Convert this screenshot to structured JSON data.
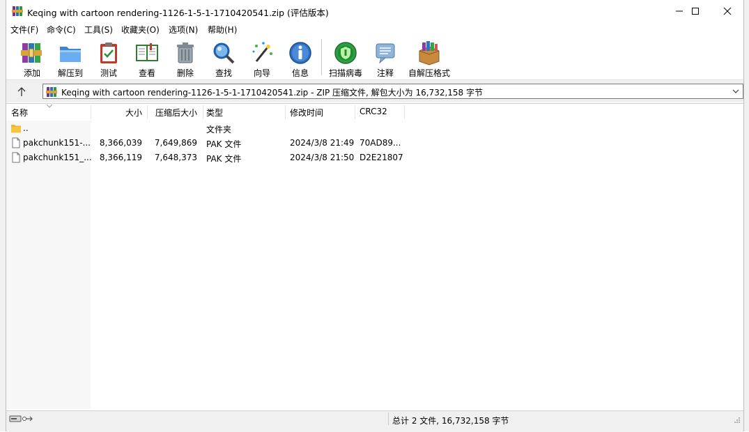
{
  "window": {
    "title": "Keqing with cartoon rendering-1126-1-5-1-1710420541.zip (评估版本)",
    "controls": [
      "minimize",
      "maximize",
      "close"
    ]
  },
  "menu": [
    {
      "label": "文件(F)"
    },
    {
      "label": "命令(C)"
    },
    {
      "label": "工具(S)"
    },
    {
      "label": "收藏夹(O)"
    },
    {
      "label": "选项(N)"
    },
    {
      "label": "帮助(H)"
    }
  ],
  "toolbar": [
    {
      "label": "添加",
      "icon": "add-archive-icon"
    },
    {
      "label": "解压到",
      "icon": "extract-folder-icon"
    },
    {
      "label": "测试",
      "icon": "test-clipboard-icon"
    },
    {
      "label": "查看",
      "icon": "view-book-icon"
    },
    {
      "label": "删除",
      "icon": "trash-icon"
    },
    {
      "label": "查找",
      "icon": "magnifier-icon"
    },
    {
      "label": "向导",
      "icon": "wizard-wand-icon"
    },
    {
      "label": "信息",
      "icon": "info-icon"
    },
    {
      "label": "扫描病毒",
      "icon": "virus-scan-icon"
    },
    {
      "label": "注释",
      "icon": "comment-icon"
    },
    {
      "label": "自解压格式",
      "icon": "sfx-box-icon"
    }
  ],
  "address": {
    "path": "Keqing with cartoon rendering-1126-1-5-1-1710420541.zip - ZIP 压缩文件, 解包大小为 16,732,158 字节"
  },
  "columns": {
    "name": "名称",
    "size": "大小",
    "packed": "压缩后大小",
    "type": "类型",
    "modified": "修改时间",
    "crc": "CRC32"
  },
  "rows": [
    {
      "name": "..",
      "size": "",
      "packed": "",
      "type": "文件夹",
      "modified": "",
      "crc": "",
      "icon": "folder-icon"
    },
    {
      "name": "pakchunk151-...",
      "size": "8,366,039",
      "packed": "7,649,869",
      "type": "PAK 文件",
      "modified": "2024/3/8 21:49",
      "crc": "70AD89...",
      "icon": "file-icon"
    },
    {
      "name": "pakchunk151_...",
      "size": "8,366,119",
      "packed": "7,648,373",
      "type": "PAK 文件",
      "modified": "2024/3/8 21:50",
      "crc": "D2E21807",
      "icon": "file-icon"
    }
  ],
  "status": {
    "text": "总计 2 文件, 16,732,158 字节"
  },
  "colors": {
    "accent": "#0078d7",
    "folder": "#f5c542",
    "background": "#ffffff",
    "chrome": "#f0f0f0"
  }
}
